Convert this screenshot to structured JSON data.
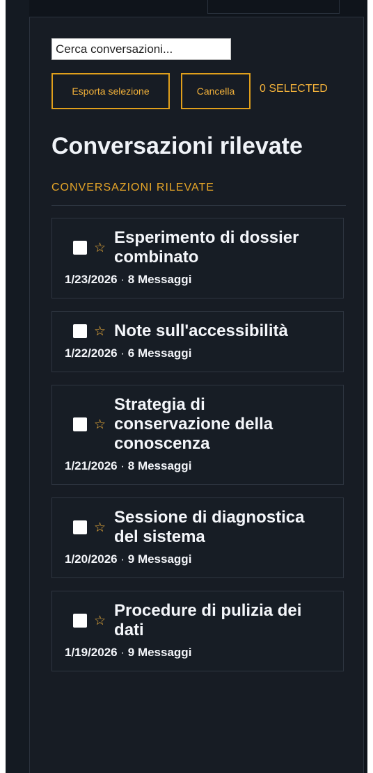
{
  "search": {
    "placeholder": "Cerca conversazioni..."
  },
  "toolbar": {
    "export_label": "Esporta selezione",
    "delete_label": "Cancella",
    "selected_count": "0 SELECTED"
  },
  "page": {
    "title": "Conversazioni rilevate",
    "section_label": "CONVERSAZIONI RILEVATE"
  },
  "conversations": [
    {
      "title": "Esperimento di dossier combinato",
      "date": "1/23/2026",
      "messages": "8 Messaggi",
      "separator": "·"
    },
    {
      "title": "Note sull'accessibilità",
      "date": "1/22/2026",
      "messages": "6 Messaggi",
      "separator": "·"
    },
    {
      "title": "Strategia di conservazione della conoscenza",
      "date": "1/21/2026",
      "messages": "8 Messaggi",
      "separator": "·"
    },
    {
      "title": "Sessione di diagnostica del sistema",
      "date": "1/20/2026",
      "messages": "9 Messaggi",
      "separator": "·"
    },
    {
      "title": "Procedure di pulizia dei dati",
      "date": "1/19/2026",
      "messages": "9 Messaggi",
      "separator": "·"
    }
  ],
  "icons": {
    "star": "star-icon",
    "checkbox": "checkbox"
  },
  "colors": {
    "accent": "#e09f1b",
    "panel_bg": "#171c24",
    "text": "#f4f6fa"
  }
}
